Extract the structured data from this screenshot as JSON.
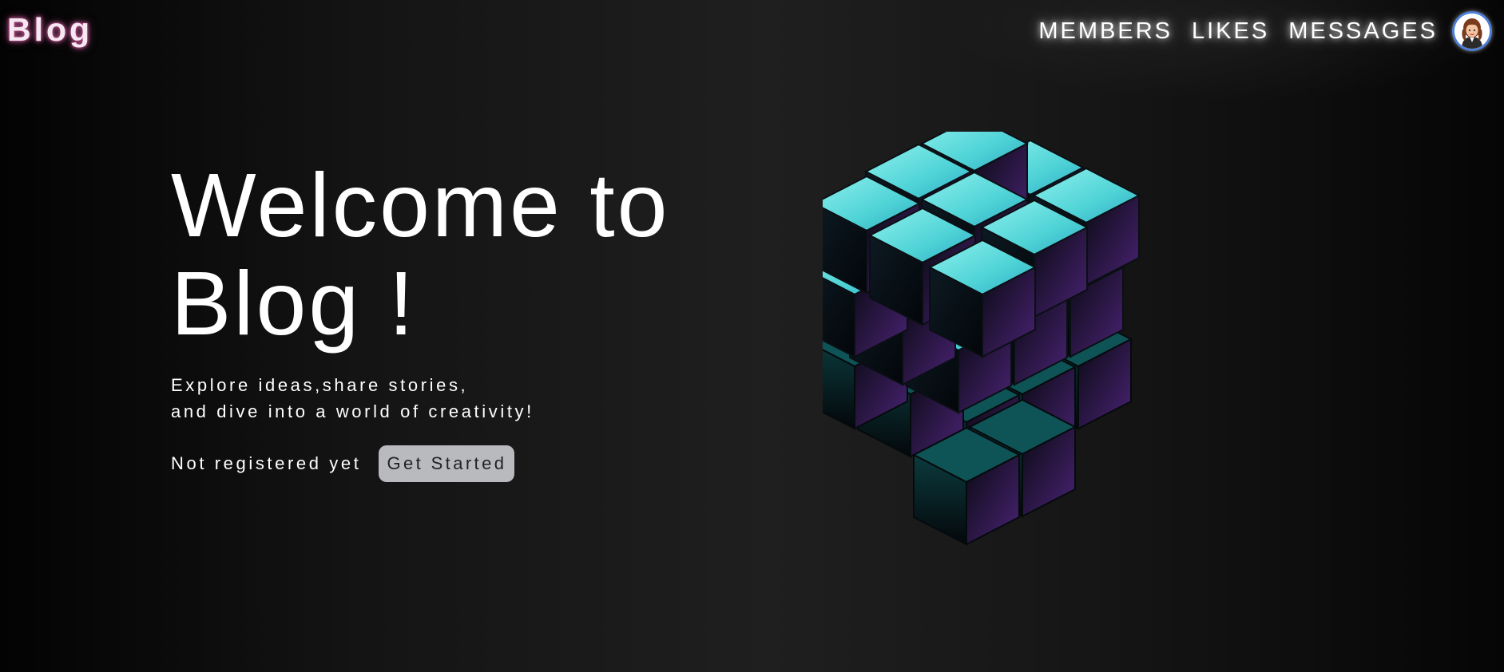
{
  "header": {
    "logo": "Blog",
    "nav": [
      "MEMBERS",
      "LIKES",
      "MESSAGES"
    ],
    "avatar_icon": "user-avatar-icon"
  },
  "hero": {
    "title_line1": "Welcome to",
    "title_line2": "Blog !",
    "subtitle_line1": "Explore ideas,share stories,",
    "subtitle_line2": "and dive into a world of creativity!",
    "cta_text": "Not registered yet",
    "cta_button": "Get Started",
    "illustration_icon": "rubiks-cube-illustration"
  },
  "colors": {
    "background": "#1b1b1b",
    "logo_glow": "#a8427e",
    "cube_top": "#5fdcdc",
    "cube_side": "#5a2a8a",
    "button_bg": "#b9babe",
    "avatar_border": "#4d7fd6"
  }
}
